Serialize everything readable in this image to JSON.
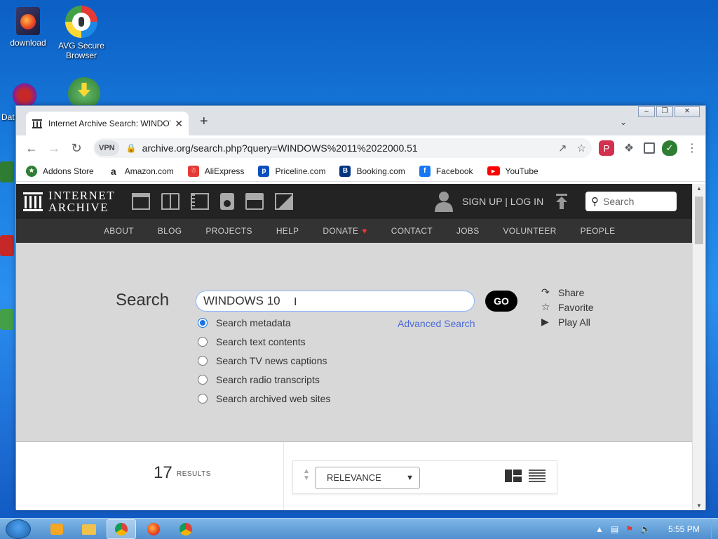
{
  "desktop": {
    "icons": [
      {
        "label": "download"
      },
      {
        "label": "AVG Secure Browser"
      }
    ],
    "partial_icon_label": "Dat"
  },
  "browser": {
    "tab_title": "Internet Archive Search: WINDOV",
    "tab_close": "✕",
    "new_tab": "+",
    "vpn_label": "VPN",
    "url": "archive.org/search.php?query=WINDOWS%2011%2022000.51",
    "bookmarks": [
      {
        "label": "Addons Store",
        "color": "#2e7d32"
      },
      {
        "label": "Amazon.com",
        "color": "#222222"
      },
      {
        "label": "AliExpress",
        "color": "#e53935"
      },
      {
        "label": "Priceline.com",
        "color": "#0a4ebf"
      },
      {
        "label": "Booking.com",
        "color": "#003580"
      },
      {
        "label": "Facebook",
        "color": "#1877f2"
      },
      {
        "label": "YouTube",
        "color": "#ff0000"
      }
    ]
  },
  "ia": {
    "logo_line1": "INTERNET",
    "logo_line2": "ARCHIVE",
    "signup": "SIGN UP | LOG IN",
    "search_placeholder": "Search",
    "nav": [
      "ABOUT",
      "BLOG",
      "PROJECTS",
      "HELP",
      "DONATE",
      "CONTACT",
      "JOBS",
      "VOLUNTEER",
      "PEOPLE"
    ],
    "search_label": "Search",
    "query": "WINDOWS 10",
    "go": "GO",
    "advanced": "Advanced Search",
    "options": [
      {
        "label": "Search metadata",
        "checked": true
      },
      {
        "label": "Search text contents",
        "checked": false
      },
      {
        "label": "Search TV news captions",
        "checked": false
      },
      {
        "label": "Search radio transcripts",
        "checked": false
      },
      {
        "label": "Search archived web sites",
        "checked": false
      }
    ],
    "actions": {
      "share": "Share",
      "favorite": "Favorite",
      "play_all": "Play All"
    },
    "results_count": "17",
    "results_label": "RESULTS",
    "sort_value": "RELEVANCE"
  },
  "taskbar": {
    "clock": "5:55 PM"
  }
}
